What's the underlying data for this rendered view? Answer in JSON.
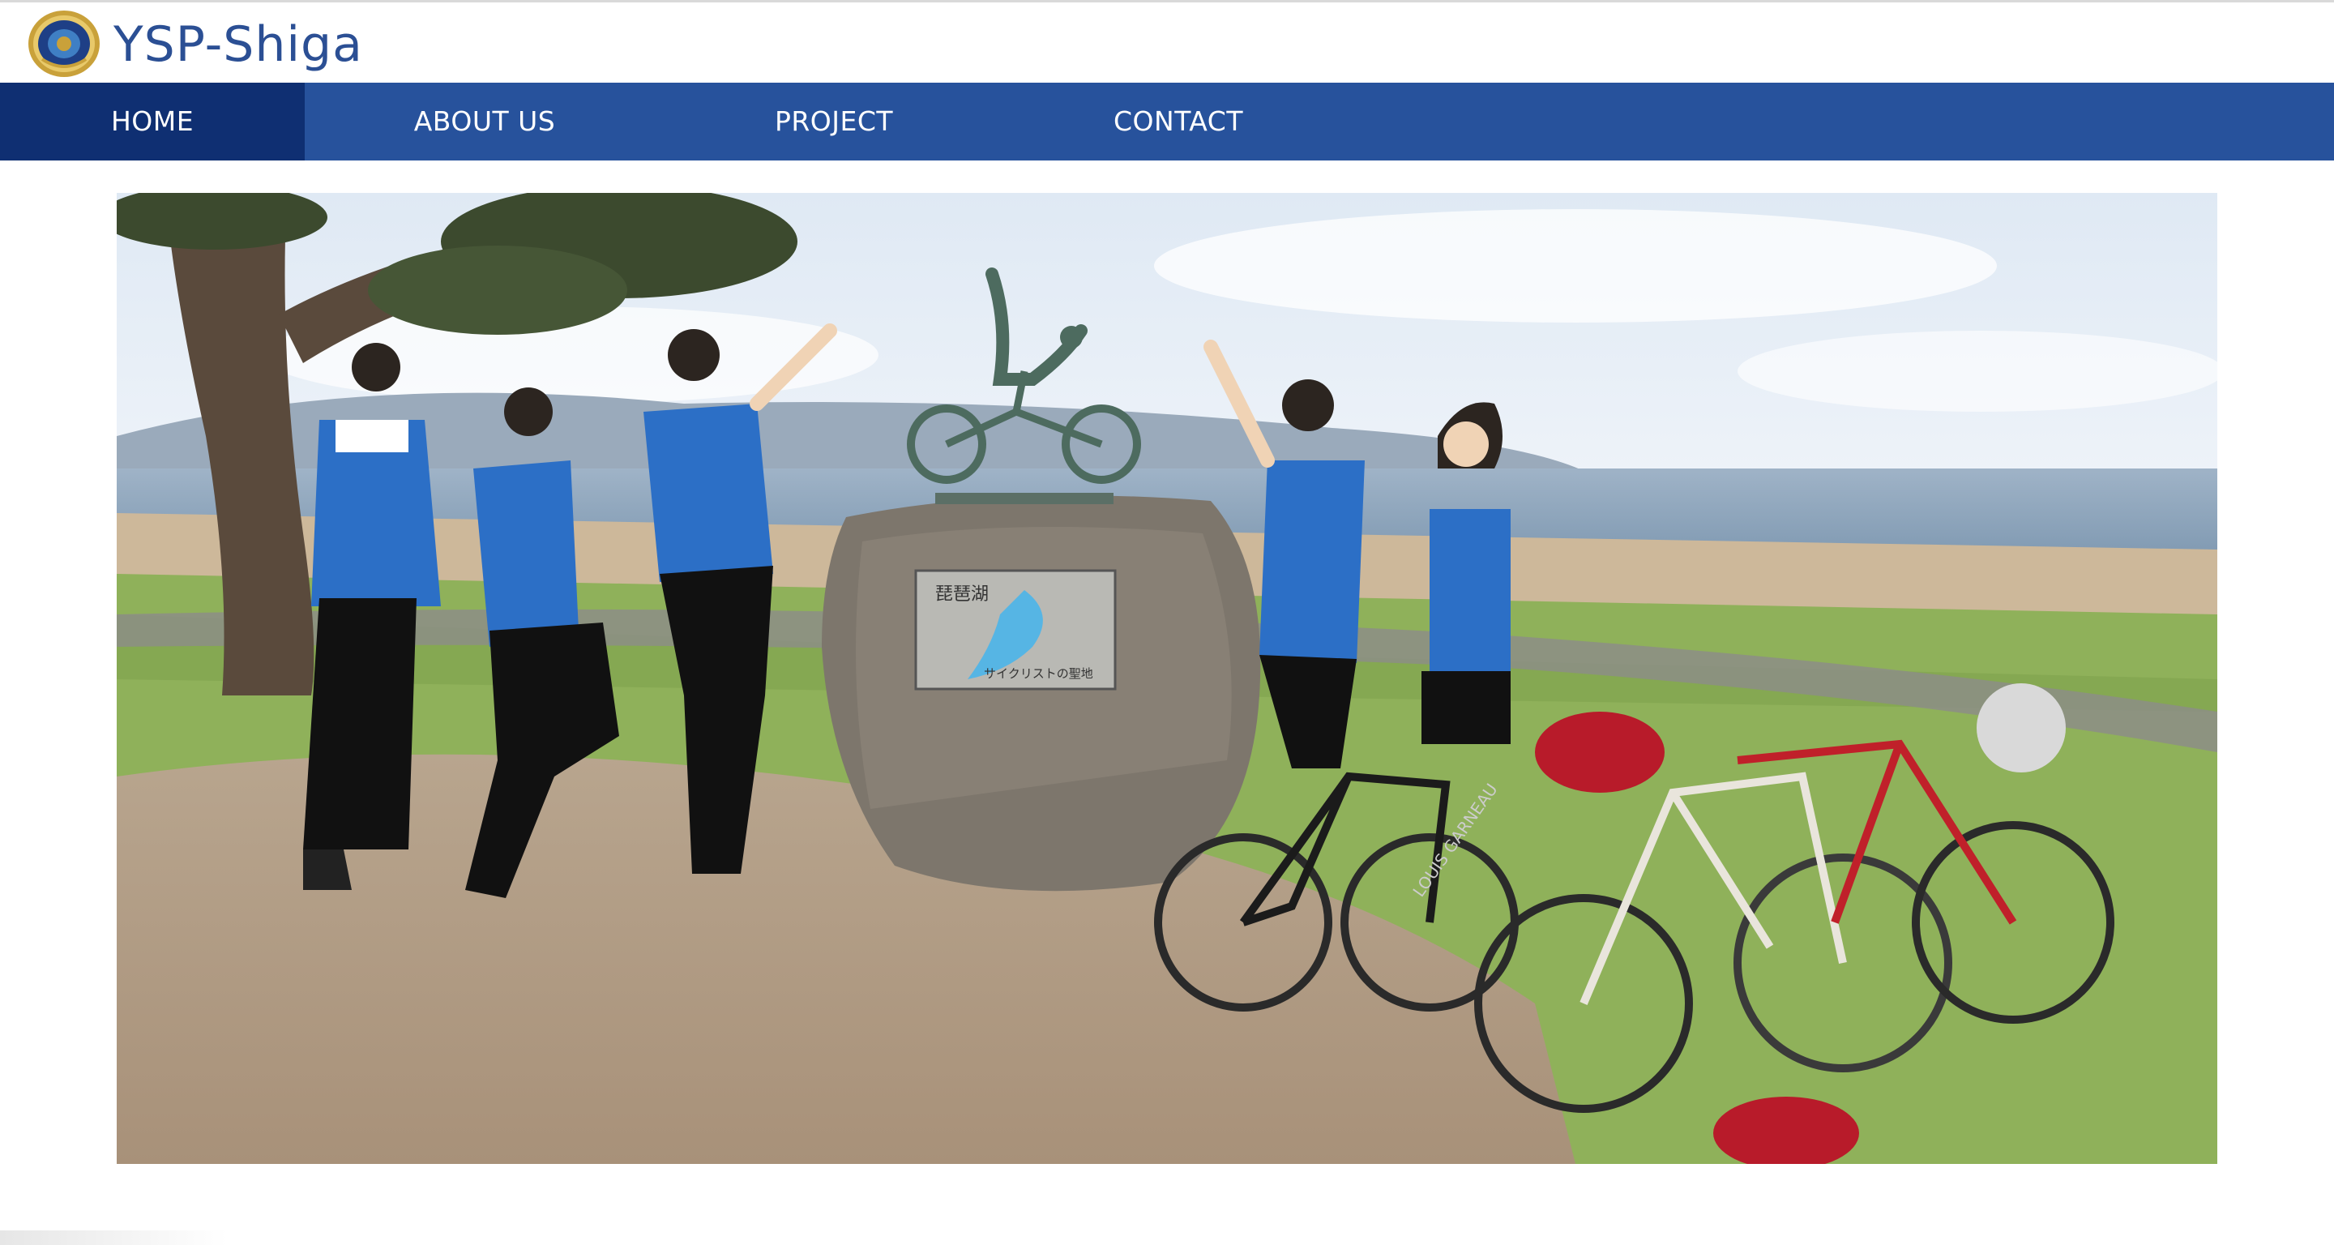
{
  "site": {
    "title": "YSP-Shiga",
    "logo_icon": "emblem-icon"
  },
  "nav": {
    "items": [
      {
        "label": "HOME",
        "active": true
      },
      {
        "label": "ABOUT US",
        "active": false
      },
      {
        "label": "PROJECT",
        "active": false
      },
      {
        "label": "CONTACT",
        "active": false
      }
    ]
  },
  "hero": {
    "plaque_title": "琵琶湖",
    "plaque_caption": "サイクリストの聖地",
    "bike_brand": "LOUIS GARNEAU"
  },
  "colors": {
    "nav_bg": "#27529c",
    "nav_active_bg": "#0f2f72",
    "title_color": "#2b4f94"
  }
}
